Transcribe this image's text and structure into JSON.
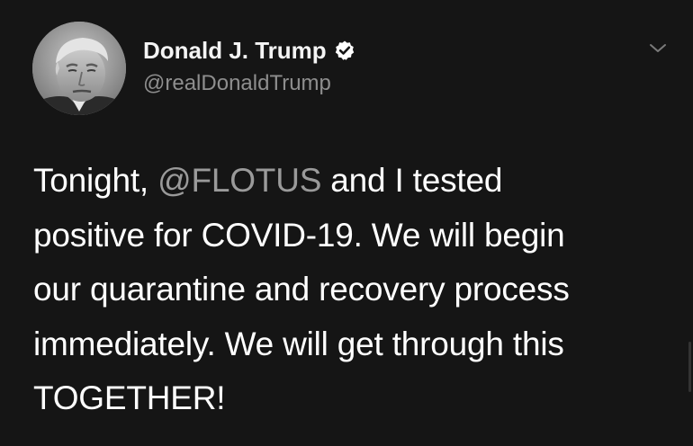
{
  "tweet": {
    "display_name": "Donald J. Trump",
    "handle": "@realDonaldTrump",
    "verified": true,
    "more_icon": "chevron-down-icon",
    "avatar_icon": "profile-photo",
    "body": {
      "line1_pre": "Tonight, ",
      "line1_mention": "@FLOTUS",
      "line1_post": " and I tested",
      "line2": "positive for COVID-19. We will begin",
      "line3": "our quarantine and recovery process",
      "line4": "immediately. We will get through this",
      "line5": "TOGETHER!"
    }
  },
  "colors": {
    "background": "#151515",
    "text": "#ffffff",
    "handle": "#8e8e8e",
    "mention": "#9a9a9a"
  }
}
